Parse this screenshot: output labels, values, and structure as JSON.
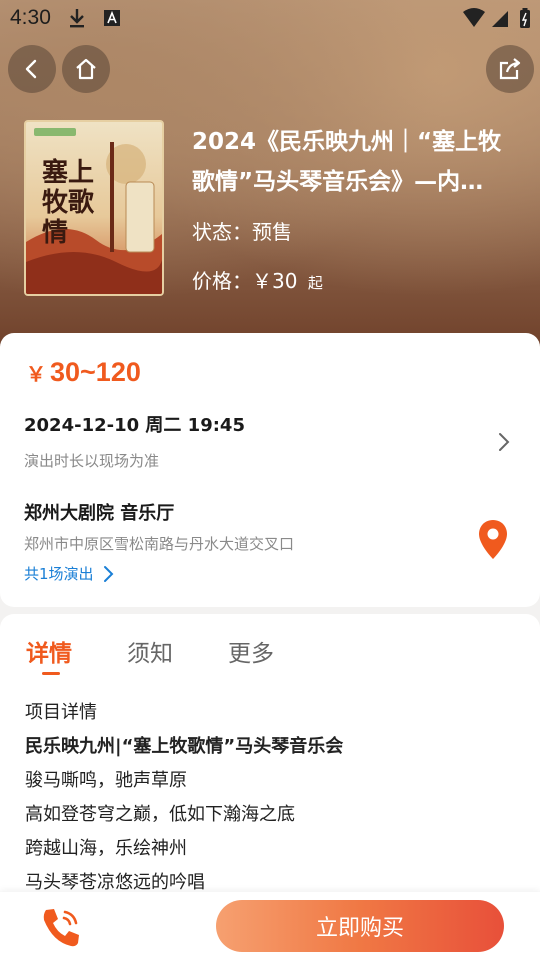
{
  "status_bar": {
    "time": "4:30"
  },
  "event": {
    "title_line1": "2024《民乐映九州｜“塞上牧",
    "title_line2": "歌情”马头琴音乐会》—内…",
    "status_label": "状态：",
    "status_value": "预售",
    "price_label": "价格：",
    "price_value": "￥30",
    "price_suffix": "起",
    "poster_text": "塞上牧歌情"
  },
  "info_card": {
    "currency": "￥",
    "price_range": "30~120",
    "datetime": "2024-12-10 周二 19:45",
    "duration_note": "演出时长以现场为准",
    "venue": "郑州大剧院 音乐厅",
    "address": "郑州市中原区雪松南路与丹水大道交叉口",
    "shows_link": "共1场演出"
  },
  "tabs": [
    {
      "label": "详情",
      "active": true
    },
    {
      "label": "须知",
      "active": false
    },
    {
      "label": "更多",
      "active": false
    }
  ],
  "details": {
    "heading": "项目详情",
    "lines": [
      "民乐映九州|“塞上牧歌情”马头琴音乐会",
      "骏马嘶鸣，驰声草原",
      "高如登苍穹之巅，低如下瀚海之底",
      "跨越山海，乐绘神州",
      "马头琴苍凉悠远的吟唱"
    ]
  },
  "bottom_bar": {
    "buy_label": "立即购买"
  },
  "colors": {
    "accent": "#f05a1e",
    "link": "#1a7fd6"
  }
}
